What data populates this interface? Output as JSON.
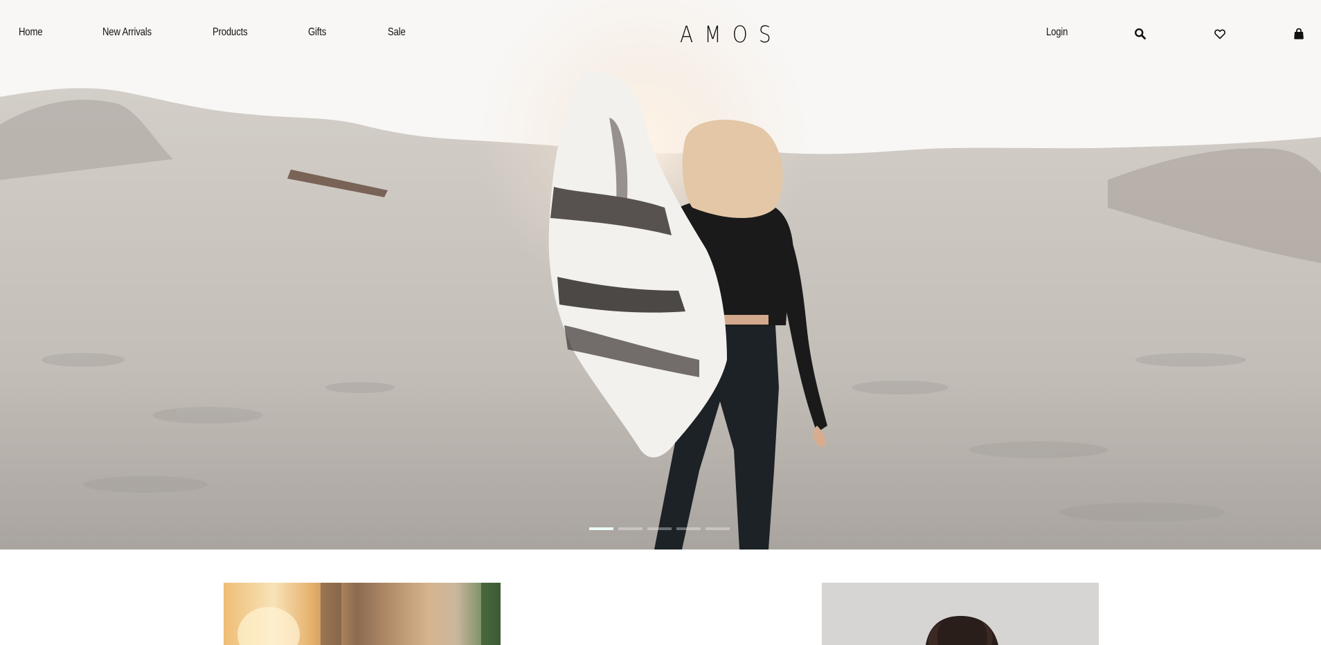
{
  "header": {
    "nav": [
      {
        "label": "Home"
      },
      {
        "label": "New Arrivals"
      },
      {
        "label": "Products"
      },
      {
        "label": "Gifts"
      },
      {
        "label": "Sale"
      }
    ],
    "logo": "AMOS",
    "login_label": "Login",
    "icons": [
      "search-icon",
      "heart-icon",
      "bag-icon"
    ]
  },
  "hero": {
    "slides_total": 5,
    "active_slide": 1
  },
  "colors": {
    "text": "#111111",
    "active_dot": "#e9fbf6",
    "background": "#ffffff"
  }
}
